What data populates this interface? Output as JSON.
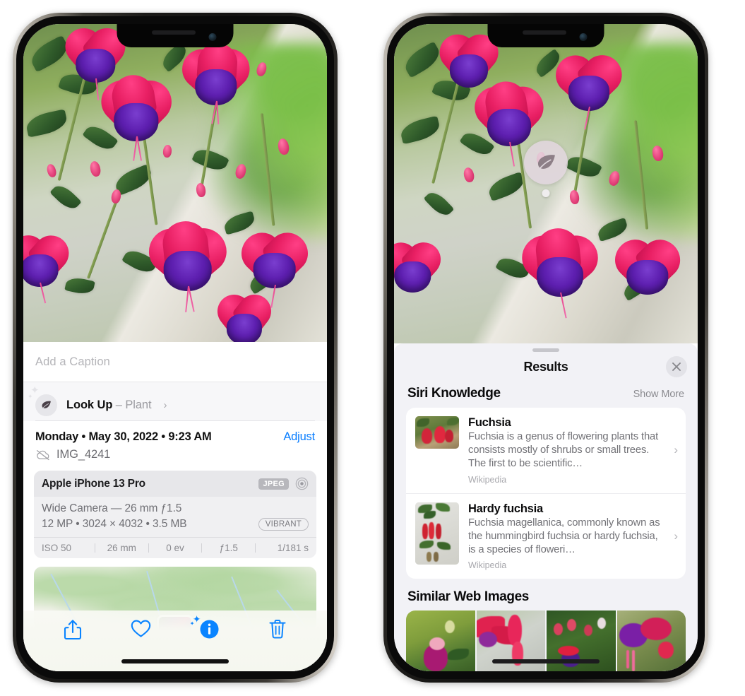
{
  "device": {
    "name": "iPhone 13 Pro",
    "icons": {
      "notch_speaker": "speaker-icon",
      "front_camera": "front-camera-icon",
      "home_indicator": "home-indicator"
    }
  },
  "left_phone": {
    "screen_name": "photos-info-view",
    "photo": {
      "alt": "fuchsia-flowers-photo"
    },
    "caption_field": {
      "placeholder": "Add a Caption",
      "value": ""
    },
    "look_up": {
      "icon": "leaf-icon",
      "label": "Look Up",
      "dash": "–",
      "subject": "Plant",
      "chevron": "›"
    },
    "meta": {
      "datetime": "Monday • May 30, 2022 • 9:23 AM",
      "adjust_label": "Adjust",
      "cloud_icon": "cloud-slash-icon",
      "filename": "IMG_4241"
    },
    "exif": {
      "device": "Apple iPhone 13 Pro",
      "format_badge": "JPEG",
      "raw_icon": "aperture-icon",
      "lens": "Wide Camera — 26 mm ƒ1.5",
      "specs": "12 MP • 3024 × 4032 • 3.5 MB",
      "style_pill": "VIBRANT",
      "footer": [
        "ISO 50",
        "26 mm",
        "0 ev",
        "ƒ1.5",
        "1/181 s"
      ]
    },
    "map": {
      "name": "location-map-thumbnail",
      "pin_thumb": "photo-pin-thumbnail"
    },
    "toolbar": {
      "share": "share-icon",
      "favorite": "heart-icon",
      "info": "info-sparkle-icon",
      "delete": "trash-icon",
      "accent_color": "#0a84ff"
    }
  },
  "right_phone": {
    "screen_name": "visual-lookup-results",
    "badge": {
      "icon": "leaf-icon",
      "name": "visual-lookup-badge"
    },
    "sheet": {
      "title": "Results",
      "close_icon": "close-icon",
      "grabber": "sheet-grabber"
    },
    "siri_knowledge": {
      "heading": "Siri Knowledge",
      "action": "Show More",
      "results": [
        {
          "title": "Fuchsia",
          "description": "Fuchsia is a genus of flowering plants that consists mostly of shrubs or small trees. The first to be scientific…",
          "source": "Wikipedia",
          "thumb": "fuchsia-thumbnail",
          "chevron": "›"
        },
        {
          "title": "Hardy fuchsia",
          "description": "Fuchsia magellanica, commonly known as the hummingbird fuchsia or hardy fuchsia, is a species of floweri…",
          "source": "Wikipedia",
          "thumb": "hardy-fuchsia-thumbnail",
          "chevron": "›"
        }
      ]
    },
    "similar_web_images": {
      "heading": "Similar Web Images",
      "items": [
        "web-image-1",
        "web-image-2",
        "web-image-3",
        "web-image-4"
      ]
    }
  },
  "colors": {
    "accent_blue": "#0a84ff",
    "sheet_bg": "#f2f2f6",
    "card_bg": "#ffffff",
    "secondary_text": "#727277",
    "exif_card": "#f0f0f2"
  }
}
